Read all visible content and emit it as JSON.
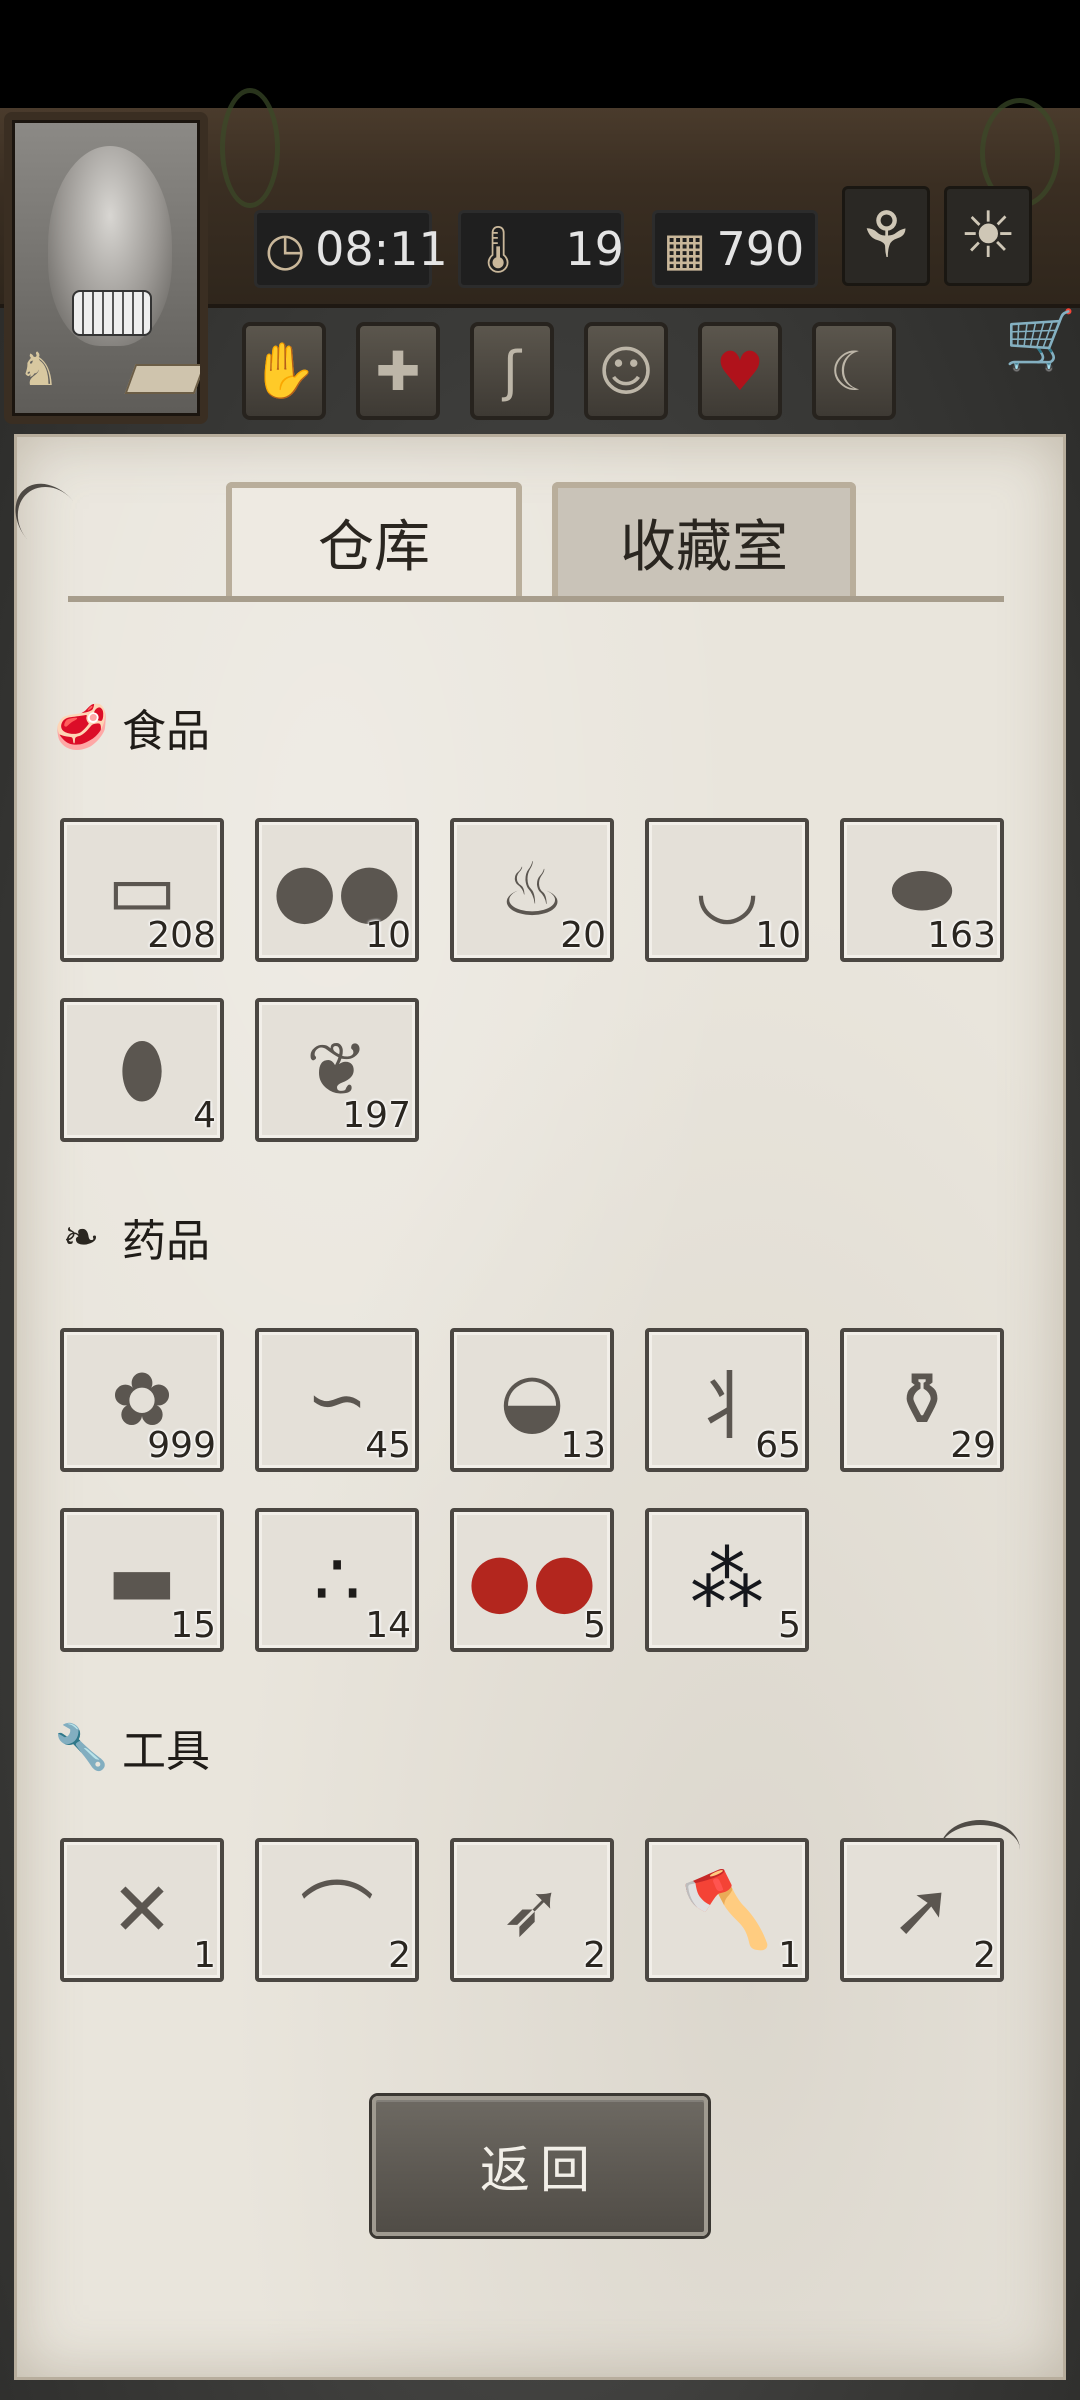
{
  "hud": {
    "time": "08:11",
    "temperature": "19",
    "days": "790",
    "time_icon": "clock-icon",
    "temperature_icon": "thermometer-icon",
    "days_icon": "calendar-icon",
    "season_icon": "sprout-icon",
    "weather_icon": "sun-icon"
  },
  "status_icons": [
    "hand-icon",
    "plus-icon",
    "stomach-icon",
    "head-icon",
    "heart-icon",
    "moon-icon"
  ],
  "accent_colors": {
    "heart": "#b0121b",
    "paper": "#e9e5dc",
    "slot_border": "#4b4742"
  },
  "tabs": [
    {
      "label": "仓库",
      "active": true
    },
    {
      "label": "收藏室",
      "active": false
    }
  ],
  "sections": {
    "food": {
      "title": "食品",
      "icon": "meat-icon",
      "items": [
        {
          "icon": "raw-meat-icon",
          "count": "208"
        },
        {
          "icon": "coconut-icon",
          "count": "10"
        },
        {
          "icon": "grilled-meat-icon",
          "count": "20"
        },
        {
          "icon": "coconut-bowl-icon",
          "count": "10"
        },
        {
          "icon": "potato-icon",
          "count": "163"
        },
        {
          "icon": "bean-icon",
          "count": "4"
        },
        {
          "icon": "fruit-pod-icon",
          "count": "197"
        }
      ]
    },
    "medicine": {
      "title": "药品",
      "icon": "leaf-icon",
      "items": [
        {
          "icon": "herb-branch-icon",
          "count": "999"
        },
        {
          "icon": "bandage-icon",
          "count": "45"
        },
        {
          "icon": "bowl-icon",
          "count": "13"
        },
        {
          "icon": "ginseng-icon",
          "count": "65"
        },
        {
          "icon": "oil-bottle-icon",
          "count": "29"
        },
        {
          "icon": "plaster-icon",
          "count": "15"
        },
        {
          "icon": "black-pills-icon",
          "count": "14"
        },
        {
          "icon": "red-berries-icon",
          "count": "5"
        },
        {
          "icon": "dark-berries-icon",
          "count": "5"
        }
      ]
    },
    "tools": {
      "title": "工具",
      "icon": "wrench-icon",
      "items": [
        {
          "icon": "crossbow-icon",
          "count": "1"
        },
        {
          "icon": "bow-icon",
          "count": "2"
        },
        {
          "icon": "longbow-icon",
          "count": "2"
        },
        {
          "icon": "axe-icon",
          "count": "1"
        },
        {
          "icon": "spear-icon",
          "count": "2"
        }
      ]
    }
  },
  "back_label": "返回"
}
